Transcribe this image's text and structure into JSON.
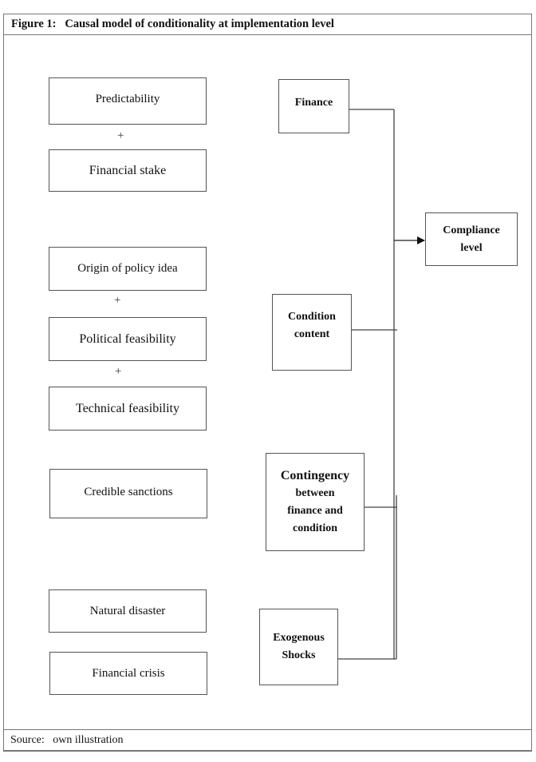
{
  "figure": {
    "title": "Figure 1:   Causal model of conditionality at implementation level",
    "source": "Source:   own illustration"
  },
  "factors": {
    "finance_group": {
      "items": [
        "Predictability",
        "Financial stake"
      ],
      "operator": "+"
    },
    "condition_group": {
      "items": [
        "Origin of policy idea",
        "Political feasibility",
        "Technical feasibility"
      ],
      "operator": "+"
    },
    "contingency_group": {
      "items": [
        "Credible sanctions"
      ]
    },
    "shock_group": {
      "items": [
        "Natural disaster",
        "Financial crisis"
      ]
    }
  },
  "determinants": {
    "finance": "Finance",
    "condition_line1": "Condition",
    "condition_line2": "content",
    "contingency_line1": "Contingency",
    "contingency_line2": "between",
    "contingency_line3": "finance and",
    "contingency_line4": "condition",
    "shocks_line1": "Exogenous",
    "shocks_line2": "Shocks"
  },
  "outcome": {
    "line1": "Compliance",
    "line2": "level"
  },
  "connections": [
    {
      "from": "Finance",
      "to": "Compliance level"
    },
    {
      "from": "Condition content",
      "to": "Compliance level"
    },
    {
      "from": "Contingency between finance and condition",
      "to": "Compliance level"
    },
    {
      "from": "Exogenous Shocks",
      "to": "Compliance level"
    }
  ]
}
